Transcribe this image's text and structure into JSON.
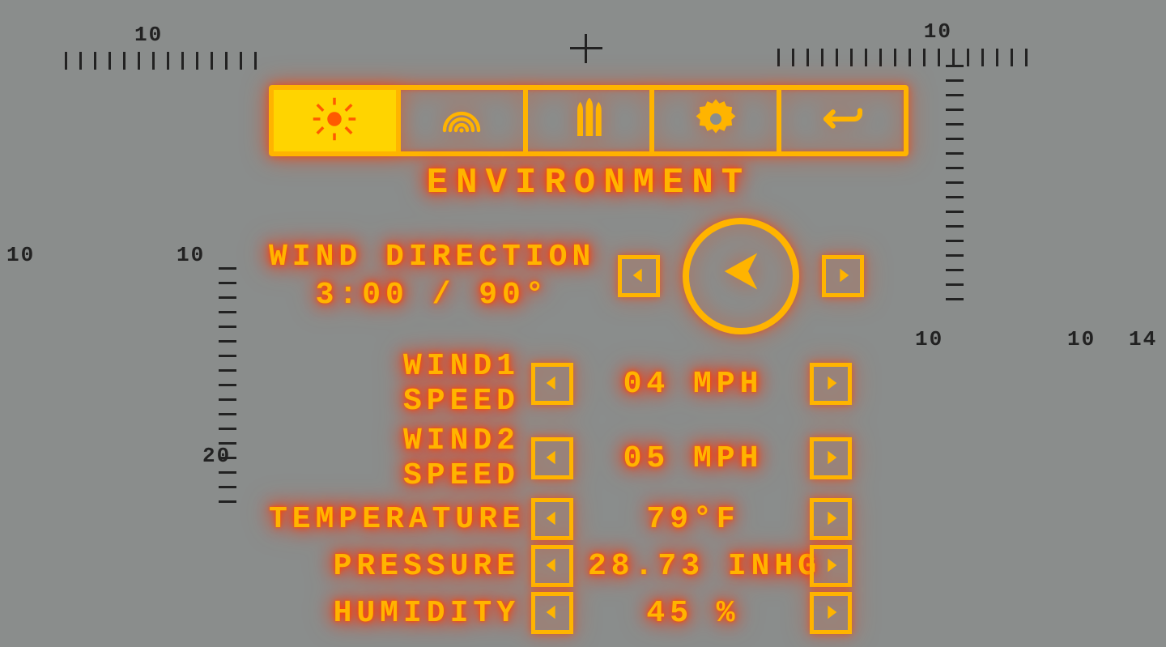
{
  "page_title": "ENVIRONMENT",
  "tabs": [
    {
      "id": "environment",
      "icon": "sun-icon",
      "active": true
    },
    {
      "id": "targeting",
      "icon": "radar-icon",
      "active": false
    },
    {
      "id": "ammo",
      "icon": "bullets-icon",
      "active": false
    },
    {
      "id": "settings",
      "icon": "gear-icon",
      "active": false
    },
    {
      "id": "back",
      "icon": "back-icon",
      "active": false
    }
  ],
  "wind_direction": {
    "label": "WIND DIRECTION",
    "value": "3:00 / 90°",
    "clock": "3:00",
    "degrees": 90
  },
  "reticle_labels": {
    "top_left": "10",
    "top_right": "10",
    "left_outer": "10",
    "left_inner": "10",
    "left_20": "20",
    "right_10a": "10",
    "right_10b": "10",
    "right_14": "14"
  },
  "rows": [
    {
      "label": "WIND1 SPEED",
      "value": "04 MPH",
      "raw": 4,
      "unit": "MPH"
    },
    {
      "label": "WIND2 SPEED",
      "value": "05 MPH",
      "raw": 5,
      "unit": "MPH"
    },
    {
      "label": "TEMPERATURE",
      "value": "79°F",
      "raw": 79,
      "unit": "°F"
    },
    {
      "label": "PRESSURE",
      "value": "28.73 INHG",
      "raw": 28.73,
      "unit": "INHG"
    },
    {
      "label": "HUMIDITY",
      "value": "45 %",
      "raw": 45,
      "unit": "%"
    }
  ],
  "colors": {
    "hud": "#ffb400",
    "glow": "#ff4200",
    "active_bg": "#ffd400",
    "reticle": "#222"
  }
}
